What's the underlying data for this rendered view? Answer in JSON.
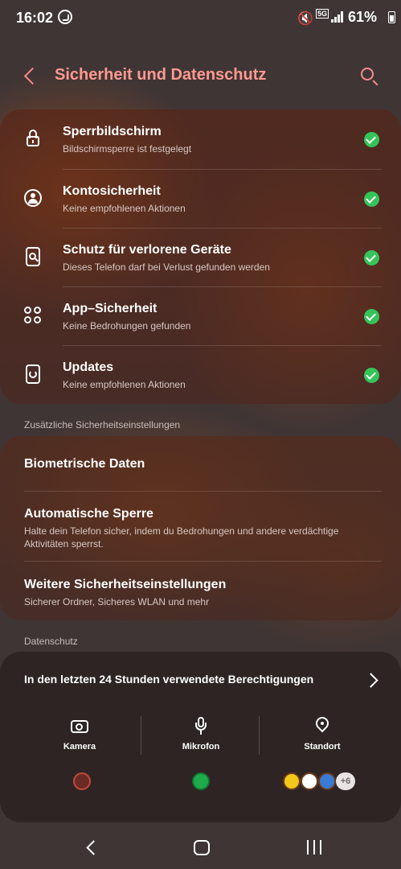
{
  "status_bar": {
    "time": "16:02",
    "network": "5G",
    "battery": "61%"
  },
  "header": {
    "title": "Sicherheit und Datenschutz"
  },
  "security_items": [
    {
      "title": "Sperrbildschirm",
      "subtitle": "Bildschirmsperre ist festgelegt",
      "icon": "lock-icon",
      "status": "ok"
    },
    {
      "title": "Kontosicherheit",
      "subtitle": "Keine empfohlenen Aktionen",
      "icon": "account-icon",
      "status": "ok"
    },
    {
      "title": "Schutz für verlorene Geräte",
      "subtitle": "Dieses Telefon darf bei Verlust gefunden werden",
      "icon": "find-device-icon",
      "status": "ok"
    },
    {
      "title": "App–Sicherheit",
      "subtitle": "Keine Bedrohungen gefunden",
      "icon": "apps-icon",
      "status": "ok"
    },
    {
      "title": "Updates",
      "subtitle": "Keine empfohlenen Aktionen",
      "icon": "update-icon",
      "status": "ok"
    }
  ],
  "additional": {
    "label": "Zusätzliche Sicherheitseinstellungen",
    "items": [
      {
        "title": "Biometrische Daten",
        "subtitle": ""
      },
      {
        "title": "Automatische Sperre",
        "subtitle": "Halte dein Telefon sicher, indem du Bedrohungen und andere verdächtige Aktivitäten sperrst."
      },
      {
        "title": "Weitere Sicherheitseinstellungen",
        "subtitle": "Sicherer Ordner, Sicheres WLAN und mehr"
      }
    ]
  },
  "privacy": {
    "label": "Datenschutz",
    "permissions_title": "In den letzten 24 Stunden verwendete Berechtigungen",
    "columns": [
      {
        "label": "Kamera",
        "icon": "camera-icon"
      },
      {
        "label": "Mikrofon",
        "icon": "microphone-icon"
      },
      {
        "label": "Standort",
        "icon": "location-icon"
      }
    ],
    "more_count": "+6"
  },
  "colors": {
    "accent": "#ff9a90",
    "check": "#34c45a",
    "background": "#3f3535"
  }
}
